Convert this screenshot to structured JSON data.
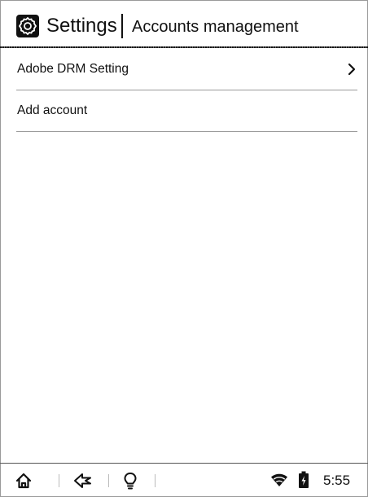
{
  "header": {
    "title": "Settings",
    "subtitle": "Accounts management",
    "icon": "gear-icon"
  },
  "list": {
    "items": [
      {
        "label": "Adobe DRM Setting",
        "has_chevron": true
      },
      {
        "label": "Add account",
        "has_chevron": false
      }
    ]
  },
  "status_bar": {
    "time": "5:55",
    "icons": [
      "home-icon",
      "back-icon",
      "light-bulb-icon",
      "wifi-icon",
      "battery-icon"
    ]
  }
}
